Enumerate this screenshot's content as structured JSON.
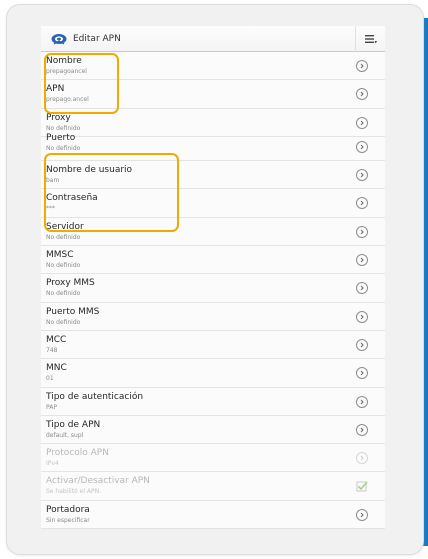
{
  "actionbar": {
    "title": "Editar APN",
    "app_icon": "settings-gear-icon",
    "menu_icon": "overflow-menu-icon"
  },
  "settings": [
    {
      "label": "Nombre",
      "value": "prepagoancel",
      "control": "chevron"
    },
    {
      "label": "APN",
      "value": "prepago.ancel",
      "control": "chevron"
    },
    {
      "label": "Proxy",
      "value": "No definido",
      "control": "chevron"
    },
    {
      "label": "Puerto",
      "value": "No definido",
      "control": "chevron"
    },
    {
      "label": "Nombre de usuario",
      "value": "bam",
      "control": "chevron"
    },
    {
      "label": "Contraseña",
      "value": "***",
      "control": "chevron"
    },
    {
      "label": "Servidor",
      "value": "No definido",
      "control": "chevron"
    },
    {
      "label": "MMSC",
      "value": "No definido",
      "control": "chevron"
    },
    {
      "label": "Proxy MMS",
      "value": "No definido",
      "control": "chevron"
    },
    {
      "label": "Puerto MMS",
      "value": "No definido",
      "control": "chevron"
    },
    {
      "label": "MCC",
      "value": "748",
      "control": "chevron"
    },
    {
      "label": "MNC",
      "value": "01",
      "control": "chevron"
    },
    {
      "label": "Tipo de autenticación",
      "value": "PAP",
      "control": "chevron"
    },
    {
      "label": "Tipo de APN",
      "value": "default, supl",
      "control": "chevron"
    },
    {
      "label": "Protocolo APN",
      "value": "IPv4",
      "control": "chevron",
      "disabled": true
    },
    {
      "label": "Activar/Desactivar APN",
      "value": "Se habilitó el APN.",
      "control": "checkbox",
      "checked": true,
      "disabled": true
    },
    {
      "label": "Portadora",
      "value": "Sin especificar",
      "control": "chevron"
    }
  ],
  "colors": {
    "highlight": "#f2a900",
    "accent_stripe": "#1f86d2"
  }
}
